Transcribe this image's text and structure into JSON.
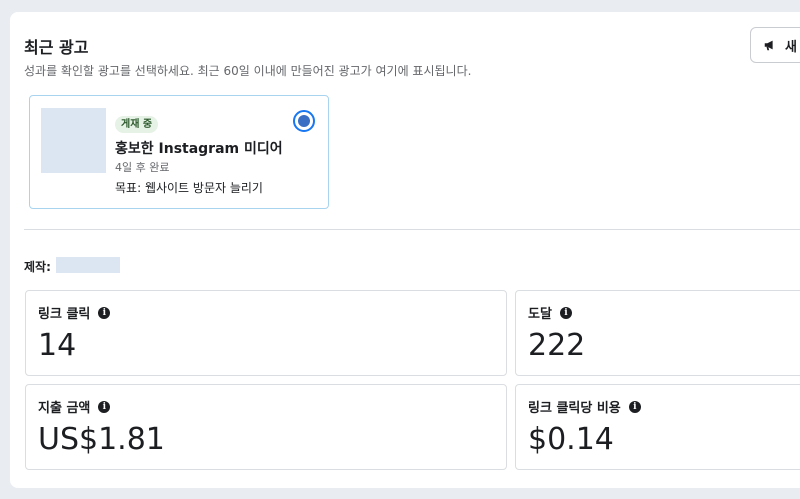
{
  "header": {
    "title": "최근 광고",
    "subtitle": "성과를 확인할 광고를 선택하세요. 최근 60일 이내에 만들어진 광고가 여기에 표시됩니다.",
    "new_button_label": "새"
  },
  "ad_card": {
    "status_badge": "게재 중",
    "name": "홍보한 Instagram 미디어",
    "meta": "4일 후 완료",
    "goal": "목표: 웹사이트 방문자 늘리기",
    "selected": true
  },
  "creator": {
    "label": "제작:"
  },
  "metrics": [
    {
      "label": "링크 클릭",
      "value": "14"
    },
    {
      "label": "도달",
      "value": "222"
    },
    {
      "label": "지출 금액",
      "value": "US$1.81"
    },
    {
      "label": "링크 클릭당 비용",
      "value": "$0.14"
    }
  ],
  "icons": {
    "megaphone": "megaphone-icon",
    "info": "info-icon"
  },
  "colors": {
    "accent": "#1877f2",
    "radio_dot": "#3a6fc4",
    "placeholder": "#dbe6f2",
    "badge_bg": "#e6f2e6"
  }
}
